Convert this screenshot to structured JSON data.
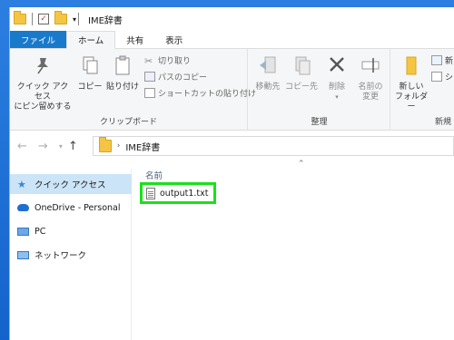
{
  "window": {
    "title": "IME辞書"
  },
  "tabs": [
    {
      "label": "ファイル"
    },
    {
      "label": "ホーム"
    },
    {
      "label": "共有"
    },
    {
      "label": "表示"
    }
  ],
  "ribbon": {
    "clipboard": {
      "pin_label_line1": "クイック アクセス",
      "pin_label_line2": "にピン留めする",
      "copy_label": "コピー",
      "paste_label": "貼り付け",
      "cut_label": "切り取り",
      "copy_path_label": "パスのコピー",
      "paste_shortcut_label": "ショートカットの貼り付け",
      "group_label": "クリップボード"
    },
    "organize": {
      "move_label": "移動先",
      "copyto_label": "コピー先",
      "delete_label": "削除",
      "rename_line1": "名前の",
      "rename_line2": "変更",
      "group_label": "整理"
    },
    "new": {
      "new_folder_line1": "新しい",
      "new_folder_line2": "フォルダー",
      "new_item_partial": "新",
      "shortcut_partial": "シ",
      "group_label_partial": "新規"
    }
  },
  "address": {
    "path": "IME辞書"
  },
  "navpane": {
    "items": [
      {
        "label": "クイック アクセス"
      },
      {
        "label": "OneDrive - Personal"
      },
      {
        "label": "PC"
      },
      {
        "label": "ネットワーク"
      }
    ]
  },
  "files": {
    "column_name": "名前",
    "items": [
      {
        "name": "output1.txt"
      }
    ]
  }
}
